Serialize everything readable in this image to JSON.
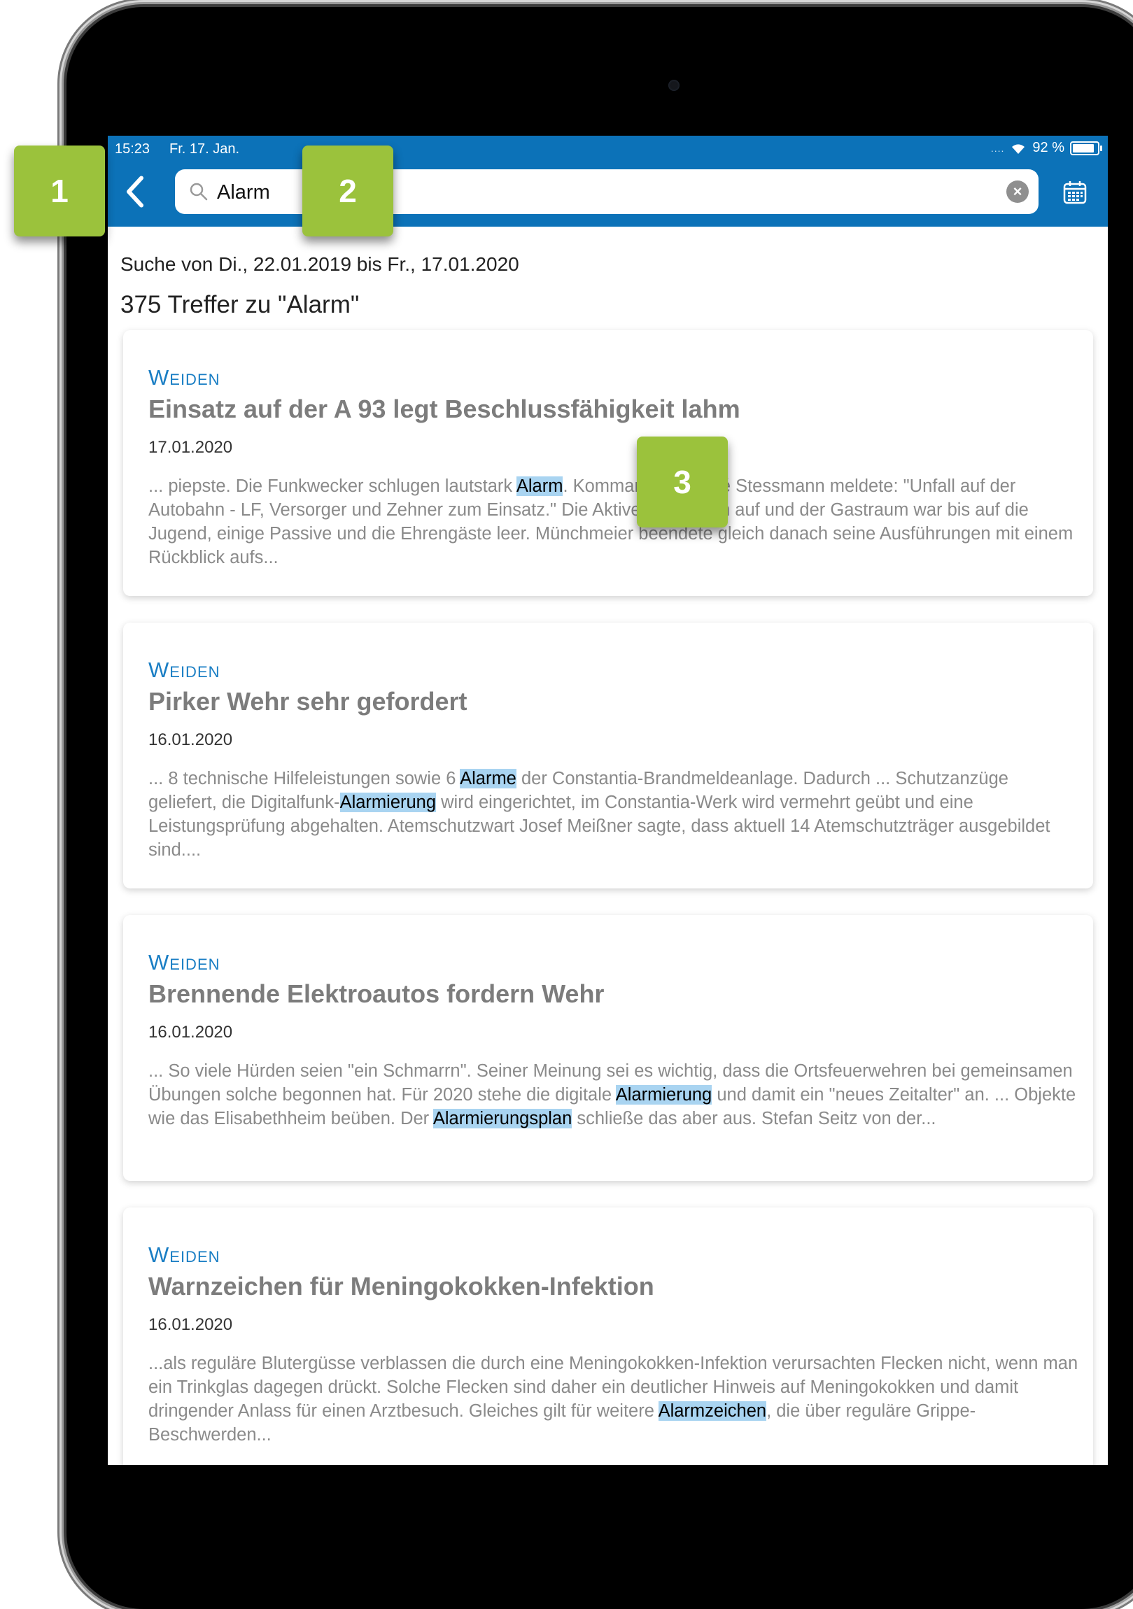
{
  "status": {
    "time": "15:23",
    "date": "Fr. 17. Jan.",
    "signal": "....",
    "battery": "92 %"
  },
  "header": {
    "back_icon": "chevron-left-icon",
    "search_value": "Alarm",
    "search_icon": "search-icon",
    "clear_icon": "clear-icon",
    "calendar_icon": "calendar-icon"
  },
  "results": {
    "range": "Suche von Di., 22.01.2019 bis Fr., 17.01.2020",
    "count": "375 Treffer zu \"Alarm\""
  },
  "articles": [
    {
      "region": "WEIDEN",
      "title": "Einsatz auf der A 93 legt Beschlussfähigkeit lahm",
      "date": "17.01.2020",
      "teaser_parts": [
        {
          "t": "... piepste. Die Funkwecker schlugen lautstark "
        },
        {
          "t": "Alarm",
          "hl": true
        },
        {
          "t": ". Kommandant André Stessmann meldete: \"Unfall auf der Autobahn - LF, Versorger und Zehner zum Einsatz.\" Die Aktiven sprangen auf und der Gastraum war bis auf die Jugend, einige Passive und die Ehrengäste leer. Münchmeier beendete gleich danach seine Ausführungen mit einem Rückblick aufs..."
        }
      ]
    },
    {
      "region": "WEIDEN",
      "title": "Pirker Wehr sehr gefordert",
      "date": "16.01.2020",
      "teaser_parts": [
        {
          "t": "... 8 technische Hilfeleistungen sowie 6 "
        },
        {
          "t": "Alarme",
          "hl": true
        },
        {
          "t": " der Constantia-Brandmeldeanlage. Dadurch ... Schutzanzüge geliefert, die Digitalfunk-"
        },
        {
          "t": "Alarmierung",
          "hl": true
        },
        {
          "t": " wird eingerichtet, im Constantia-Werk wird vermehrt geübt und eine Leistungsprüfung abgehalten. Atemschutzwart Josef Meißner sagte, dass aktuell 14 Atemschutzträger ausgebildet sind...."
        }
      ]
    },
    {
      "region": "WEIDEN",
      "title": "Brennende Elektroautos fordern Wehr",
      "date": "16.01.2020",
      "teaser_parts": [
        {
          "t": "... So viele Hürden seien \"ein Schmarrn\". Seiner Meinung sei es wichtig, dass die Ortsfeuerwehren bei gemeinsamen Übungen solche begonnen hat. Für 2020 stehe die digitale "
        },
        {
          "t": "Alarmierung",
          "hl": true
        },
        {
          "t": " und damit ein \"neues Zeitalter\" an. ... Objekte wie das Elisabethheim beüben. Der "
        },
        {
          "t": "Alarmierungsplan",
          "hl": true
        },
        {
          "t": " schließe das aber aus. Stefan Seitz von der..."
        }
      ]
    },
    {
      "region": "WEIDEN",
      "title": "Warnzeichen für Meningokokken-Infektion",
      "date": "16.01.2020",
      "teaser_parts": [
        {
          "t": "...als reguläre Blutergüsse verblassen die durch eine Meningokokken-Infektion verursachten Flecken nicht, wenn man ein Trinkglas dagegen drückt. Solche Flecken sind daher ein deutlicher Hinweis auf Meningokokken und damit dringender Anlass für einen Arztbesuch. Gleiches gilt für weitere "
        },
        {
          "t": "Alarmzeichen",
          "hl": true
        },
        {
          "t": ", die über reguläre Grippe-Beschwerden..."
        }
      ]
    }
  ],
  "annotations": [
    "1",
    "2",
    "3"
  ],
  "colors": {
    "accent": "#0c72b8",
    "region": "#1a7ec4",
    "highlight": "#a9d4f1",
    "annotation": "#9bc23c"
  }
}
